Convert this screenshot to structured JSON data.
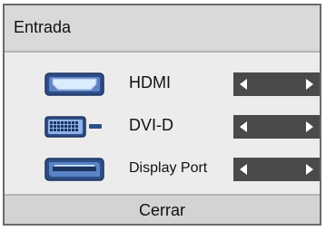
{
  "dialog": {
    "title": "Entrada",
    "close_label": "Cerrar"
  },
  "inputs": [
    {
      "label": "HDMI",
      "icon": "hdmi-port-icon"
    },
    {
      "label": "DVI-D",
      "icon": "dvi-port-icon"
    },
    {
      "label": "Display Port",
      "icon": "displayport-icon"
    }
  ],
  "colors": {
    "panel_border": "#6a6a6a",
    "panel_background": "#ececec",
    "header_background": "#d9d9d9",
    "selector_background": "#4a4a4a",
    "icon_fill": "#3e5f9a",
    "icon_highlight": "#d9ecff"
  }
}
